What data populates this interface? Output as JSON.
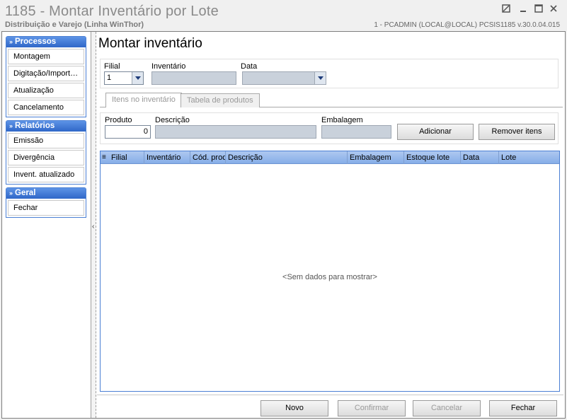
{
  "window": {
    "title": "1185 - Montar Inventário por Lote",
    "subtitle": "Distribuição e Varejo (Linha WinThor)",
    "sysinfo": "1 - PCADMIN (LOCAL@LOCAL)   PCSIS1185  v.30.0.04.015"
  },
  "sidebar": {
    "groups": [
      {
        "title": "Processos",
        "items": [
          "Montagem",
          "Digitação/Import…",
          "Atualização",
          "Cancelamento"
        ]
      },
      {
        "title": "Relatórios",
        "items": [
          "Emissão",
          "Divergência",
          "Invent. atualizado"
        ]
      },
      {
        "title": "Geral",
        "items": [
          "Fechar"
        ]
      }
    ]
  },
  "page_title": "Montar inventário",
  "filters": {
    "filial_label": "Filial",
    "filial_value": "1",
    "inventario_label": "Inventário",
    "data_label": "Data"
  },
  "tabs": [
    "Itens no inventário",
    "Tabela de produtos"
  ],
  "product": {
    "produto_label": "Produto",
    "produto_value": "0",
    "descricao_label": "Descrição",
    "embalagem_label": "Embalagem",
    "add_label": "Adicionar",
    "remove_label": "Remover itens"
  },
  "grid": {
    "columns": [
      "Filial",
      "Inventário",
      "Cód. prod",
      "Descrição",
      "Embalagem",
      "Estoque lote",
      "Data",
      "Lote"
    ],
    "empty_text": "<Sem dados para mostrar>"
  },
  "footer": {
    "novo": "Novo",
    "confirmar": "Confirmar",
    "cancelar": "Cancelar",
    "fechar": "Fechar"
  },
  "colors": {
    "accent": "#2f67c8",
    "grid_header": "#9dbcec"
  }
}
